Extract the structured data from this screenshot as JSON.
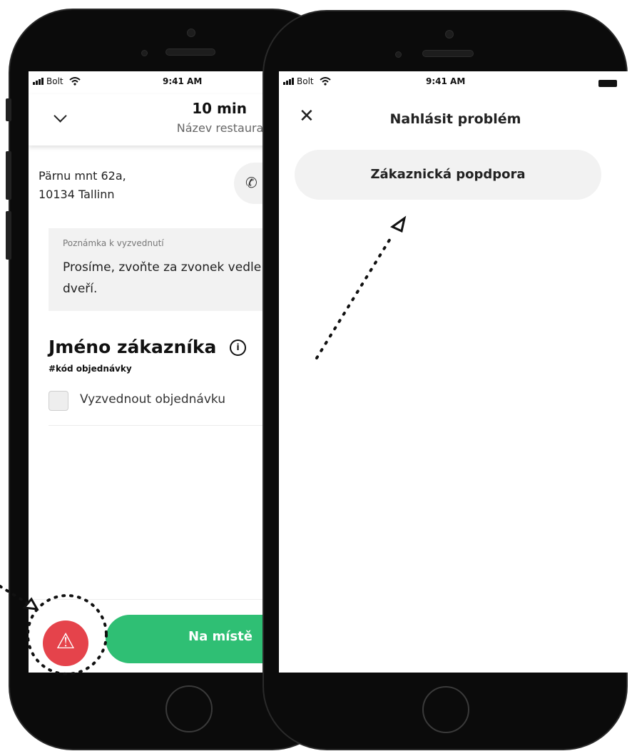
{
  "left_screen": {
    "status": {
      "carrier": "Bolt",
      "time": "9:41 AM"
    },
    "header": {
      "eta": "10 min",
      "restaurant": "Název restaurace"
    },
    "address": {
      "line1": "Pärnu mnt 62a,",
      "line2": "10134 Tallinn"
    },
    "phone_icon": "phone-icon",
    "note": {
      "label": "Poznámka k vyzvednutí",
      "text": "Prosíme, zvoňte za zvonek vedle dveří."
    },
    "customer": {
      "name": "Jméno zákazníka",
      "info_icon": "info-icon",
      "info_glyph": "i",
      "order_code": "#kód objednávky"
    },
    "pickup_checkbox_label": "Vyzvednout objednávku",
    "alert_icon": "warning-icon",
    "alert_glyph": "⚠",
    "arrive_button": "Na místě",
    "colors": {
      "alert": "#e5434b",
      "primary": "#2fbf74"
    }
  },
  "right_screen": {
    "status": {
      "carrier": "Bolt",
      "time": "9:41 AM"
    },
    "close_icon": "close-icon",
    "close_glyph": "✕",
    "title": "Nahlásit problém",
    "support_button": "Zákaznická popdpora"
  }
}
